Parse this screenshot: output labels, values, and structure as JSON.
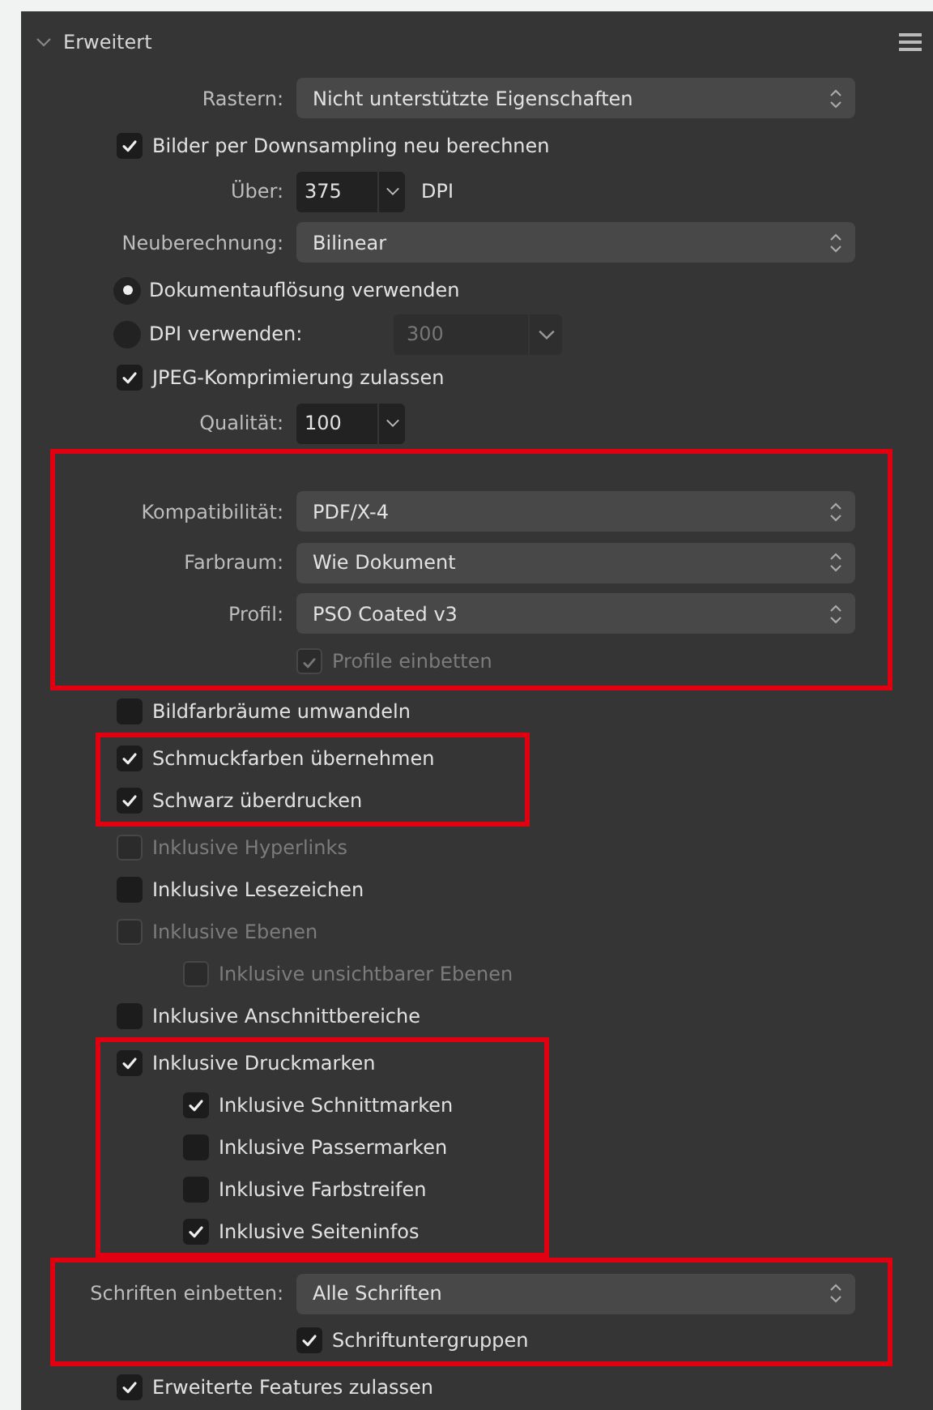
{
  "panel": {
    "title": "Erweitert",
    "expanded": true
  },
  "groups": [
    {
      "highlighted": false,
      "rows": [
        {
          "kind": "select",
          "label": "Rastern:",
          "value": "Nicht unterstützte Eigenschaften"
        },
        {
          "kind": "checkbox",
          "label": "Bilder per Downsampling neu berechnen",
          "checked": true,
          "disabled": false
        },
        {
          "kind": "number",
          "label": "Über:",
          "value": "375",
          "unit": "DPI",
          "disabled": false
        },
        {
          "kind": "select",
          "label": "Neuberechnung:",
          "value": "Bilinear"
        },
        {
          "kind": "radio",
          "label": "Dokumentauflösung verwenden",
          "selected": true
        },
        {
          "kind": "radio",
          "label": "DPI verwenden:",
          "selected": false,
          "field": {
            "value": "300",
            "disabled": true
          }
        },
        {
          "kind": "checkbox",
          "label": "JPEG-Komprimierung zulassen",
          "checked": true,
          "disabled": false
        },
        {
          "kind": "number",
          "label": "Qualität:",
          "value": "100",
          "disabled": false
        }
      ]
    },
    {
      "highlighted": true,
      "rows": [
        {
          "kind": "select",
          "label": "Kompatibilität:",
          "value": "PDF/X-4"
        },
        {
          "kind": "select",
          "label": "Farbraum:",
          "value": "Wie Dokument"
        },
        {
          "kind": "select",
          "label": "Profil:",
          "value": "PSO Coated v3"
        },
        {
          "kind": "field-checkbox",
          "label": "Profile einbetten",
          "checked": true,
          "disabled": true
        }
      ]
    },
    {
      "highlighted": false,
      "rows": [
        {
          "kind": "checkbox",
          "label": "Bildfarbräume umwandeln",
          "checked": false,
          "disabled": false
        }
      ]
    },
    {
      "highlighted": true,
      "rows": [
        {
          "kind": "checkbox",
          "label": "Schmuckfarben übernehmen",
          "checked": true,
          "disabled": false
        },
        {
          "kind": "checkbox",
          "label": "Schwarz überdrucken",
          "checked": true,
          "disabled": false
        }
      ]
    },
    {
      "highlighted": false,
      "rows": [
        {
          "kind": "checkbox",
          "label": "Inklusive Hyperlinks",
          "checked": false,
          "disabled": true
        },
        {
          "kind": "checkbox",
          "label": "Inklusive Lesezeichen",
          "checked": false,
          "disabled": false
        },
        {
          "kind": "checkbox",
          "label": "Inklusive Ebenen",
          "checked": false,
          "disabled": true,
          "children": [
            {
              "kind": "checkbox",
              "label": "Inklusive unsichtbarer Ebenen",
              "checked": false,
              "disabled": true
            }
          ]
        },
        {
          "kind": "checkbox",
          "label": "Inklusive Anschnittbereiche",
          "checked": false,
          "disabled": false
        }
      ]
    },
    {
      "highlighted": true,
      "rows": [
        {
          "kind": "checkbox",
          "label": "Inklusive Druckmarken",
          "checked": true,
          "disabled": false,
          "children": [
            {
              "kind": "checkbox",
              "label": "Inklusive Schnittmarken",
              "checked": true,
              "disabled": false
            },
            {
              "kind": "checkbox",
              "label": "Inklusive Passermarken",
              "checked": false,
              "disabled": false
            },
            {
              "kind": "checkbox",
              "label": "Inklusive Farbstreifen",
              "checked": false,
              "disabled": false
            },
            {
              "kind": "checkbox",
              "label": "Inklusive Seiteninfos",
              "checked": true,
              "disabled": false
            }
          ]
        }
      ]
    },
    {
      "highlighted": true,
      "rows": [
        {
          "kind": "select",
          "label": "Schriften einbetten:",
          "value": "Alle Schriften"
        },
        {
          "kind": "field-checkbox",
          "label": "Schriftuntergruppen",
          "checked": true,
          "disabled": false
        }
      ]
    },
    {
      "highlighted": false,
      "rows": [
        {
          "kind": "checkbox",
          "label": "Erweiterte Features zulassen",
          "checked": true,
          "disabled": false
        }
      ]
    }
  ]
}
